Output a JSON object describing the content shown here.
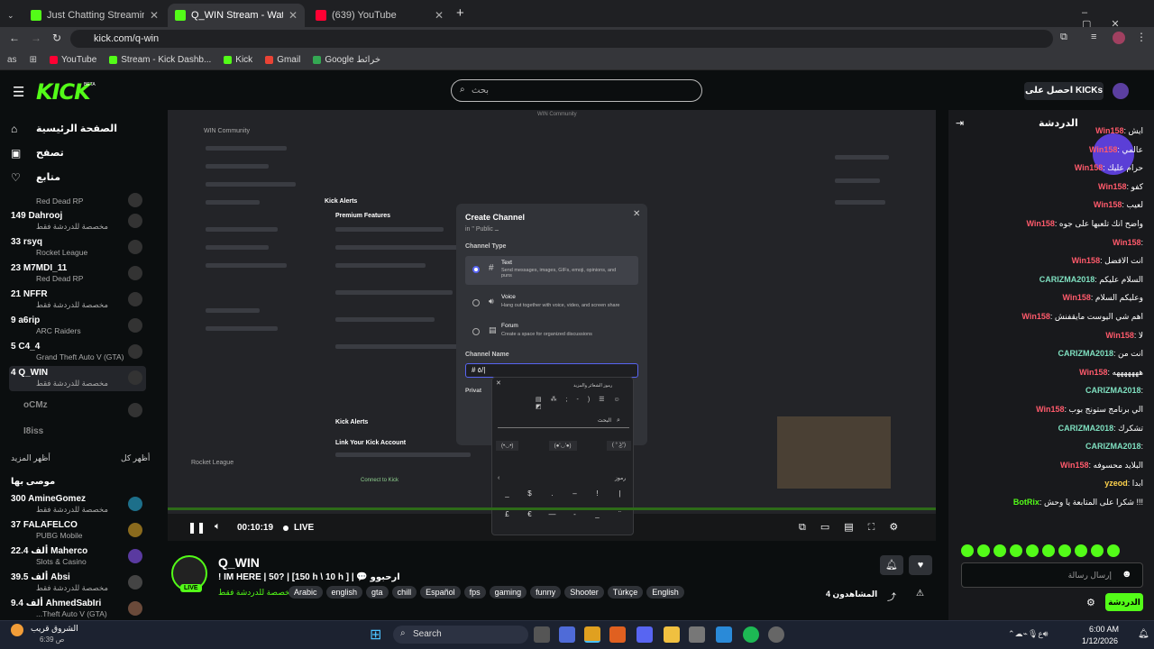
{
  "browser": {
    "tabs": [
      {
        "title": "Just Chatting Streaming - Live S",
        "color": "#53fc18"
      },
      {
        "title": "Q_WIN Stream - Watch Live",
        "color": "#53fc18"
      },
      {
        "title": "(639) YouTube",
        "color": "#ff0033"
      }
    ],
    "new_tab": "+",
    "url": "kick.com/q-win",
    "bookmarks": [
      {
        "label": "YouTube",
        "color": "#ff0033"
      },
      {
        "label": "Stream - Kick Dashb...",
        "color": "#53fc18"
      },
      {
        "label": "Kick",
        "color": "#53fc18"
      },
      {
        "label": "Gmail",
        "color": "#ea4335"
      },
      {
        "label": "Google خرائط",
        "color": "#34a853"
      }
    ],
    "profile_initials": "as"
  },
  "header": {
    "logo": "KICK",
    "logo_badge": "BETA",
    "search_placeholder": "بحث",
    "get_kicks": "احصل على KICKs",
    "accent": "#53fc18"
  },
  "sidebar": {
    "nav": [
      {
        "label": "الصفحة الرئيسية",
        "icon": "home-icon"
      },
      {
        "label": "تصفح",
        "icon": "browse-icon"
      },
      {
        "label": "متابع",
        "icon": "heart-icon"
      }
    ],
    "followed": [
      {
        "count": "",
        "name": "",
        "category": "Red Dead RP"
      },
      {
        "count": "149",
        "name": "Dahrooj",
        "category": "مخصصة للدردشة فقط"
      },
      {
        "count": "33",
        "name": "rsyq",
        "category": "Rocket League"
      },
      {
        "count": "23",
        "name": "M7MDI_11",
        "category": "Red Dead RP"
      },
      {
        "count": "21",
        "name": "NFFR",
        "category": "مخصصة للدردشة فقط"
      },
      {
        "count": "9",
        "name": "a6rip",
        "category": "ARC Raiders"
      },
      {
        "count": "5",
        "name": "C4_4",
        "category": "Grand Theft Auto V (GTA)"
      },
      {
        "count": "4",
        "name": "Q_WIN",
        "category": "مخصصة للدردشة فقط"
      },
      {
        "count": "",
        "name": "oCMz",
        "category": ""
      },
      {
        "count": "",
        "name": "I8iss",
        "category": ""
      }
    ],
    "show_more": "أظهر المزيد",
    "show_all": "أظهر كل",
    "recommended_title": "موصى بها",
    "recommended": [
      {
        "count": "300",
        "name": "AmineGomez",
        "category": "مخصصة للدردشة فقط"
      },
      {
        "count": "37",
        "name": "FALAFELCO",
        "category": "PUBG Mobile"
      },
      {
        "count": "22.4 ألف",
        "name": "Maherco",
        "category": "Slots & Casino"
      },
      {
        "count": "39.5 ألف",
        "name": "Absi",
        "category": "مخصصة للدردشة فقط"
      },
      {
        "count": "9.4 ألف",
        "name": "AhmedSabIri",
        "category": "...Theft Auto V (GTA)"
      }
    ]
  },
  "player": {
    "time": "00:10:19",
    "live": "LIVE",
    "dialog": {
      "title": "Create Channel",
      "subtitle": "in \" Public ــ",
      "type_label": "Channel Type",
      "options": [
        {
          "name": "Text",
          "desc": "Send messages, images, GIFs, emoji, opinions, and puns"
        },
        {
          "name": "Voice",
          "desc": "Hang out together with voice, video, and screen share"
        },
        {
          "name": "Forum",
          "desc": "Create a space for organized discussions"
        }
      ],
      "name_label": "Channel Name",
      "name_value": "# ٥/|",
      "private_label": "Privat",
      "emoji_search": "البحث",
      "emoji_header": "رموز الشعائر والمزيد",
      "kaomoji": [
        "(•◡•)",
        "(●'◡'●)",
        "( ° ͜ʖ°)"
      ],
      "symbols_label": "رموز",
      "symbols": [
        "_",
        "$",
        ".",
        "–",
        "!",
        "|",
        "£",
        "€",
        "—",
        "-",
        "_",
        "¨"
      ]
    },
    "background_texts": {
      "community": "WIN Community",
      "kick_alerts": "Kick Alerts",
      "premium": "Premium Features",
      "link_account": "Link Your Kick Account",
      "connect": "Connect to Kick",
      "rocket": "Rocket League",
      "win_community_window": "WIN Community"
    }
  },
  "stream": {
    "streamer": "Q_WIN",
    "title": "! IM HERE | 50? | [150 h \\ 10 h ] | 💬 ارحبوو",
    "category": "مخصصة للدردشة فقط",
    "tags": [
      "Arabic",
      "english",
      "gta",
      "chill",
      "Español",
      "fps",
      "gaming",
      "funny",
      "Shooter",
      "Türkçe",
      "English"
    ],
    "viewers": "4 المشاهدون",
    "live_badge": "LIVE"
  },
  "chat": {
    "title": "الدردشة",
    "messages": [
      {
        "user": "Win158",
        "text": "ايش",
        "color": "#ff5a6b"
      },
      {
        "user": "Win158",
        "text": "عالمي",
        "color": "#ff5a6b"
      },
      {
        "user": "Win158",
        "text": "حرام عليك",
        "color": "#ff5a6b"
      },
      {
        "user": "Win158",
        "text": "كفو",
        "color": "#ff5a6b"
      },
      {
        "user": "Win158",
        "text": "لعيب",
        "color": "#ff5a6b"
      },
      {
        "user": "Win158",
        "text": "واضح انك تلعبها على جوه",
        "color": "#ff5a6b"
      },
      {
        "user": "Win158",
        "text": "",
        "color": "#ff5a6b"
      },
      {
        "user": "Win158",
        "text": "انت الافضل",
        "color": "#ff5a6b"
      },
      {
        "user": "CARIZMA2018",
        "text": "السلام عليكم",
        "color": "#7fe0c0"
      },
      {
        "user": "Win158",
        "text": "وعليكم السلام",
        "color": "#ff5a6b"
      },
      {
        "user": "Win158",
        "text": "اهم شي اليوست مايقفنش",
        "color": "#ff5a6b"
      },
      {
        "user": "Win158",
        "text": "لا",
        "color": "#ff5a6b"
      },
      {
        "user": "CARIZMA2018",
        "text": "انت من",
        "color": "#7fe0c0"
      },
      {
        "user": "Win158",
        "text": "هههههههه",
        "color": "#ff5a6b"
      },
      {
        "user": "CARIZMA2018",
        "text": "",
        "color": "#7fe0c0"
      },
      {
        "user": "Win158",
        "text": "الي برنامج ستونج بوب",
        "color": "#ff5a6b"
      },
      {
        "user": "CARIZMA2018",
        "text": "تشكرك",
        "color": "#7fe0c0"
      },
      {
        "user": "CARIZMA2018",
        "text": "",
        "color": "#7fe0c0"
      },
      {
        "user": "Win158",
        "text": "البلايد محسوفه",
        "color": "#ff5a6b"
      },
      {
        "user": "yzeod",
        "text": "ابدا",
        "color": "#ffd34d"
      },
      {
        "user": "BotRix",
        "text": "شكرا على المتابعة يا وحش !!!",
        "color": "#53fc18"
      }
    ],
    "input_placeholder": "إرسال رسالة",
    "send_label": "الدردشة"
  },
  "taskbar": {
    "search": "Search",
    "weather": "الشروق قريب",
    "weather_time": "6:39 ص",
    "time": "6:00 AM",
    "date": "1/12/2026"
  }
}
